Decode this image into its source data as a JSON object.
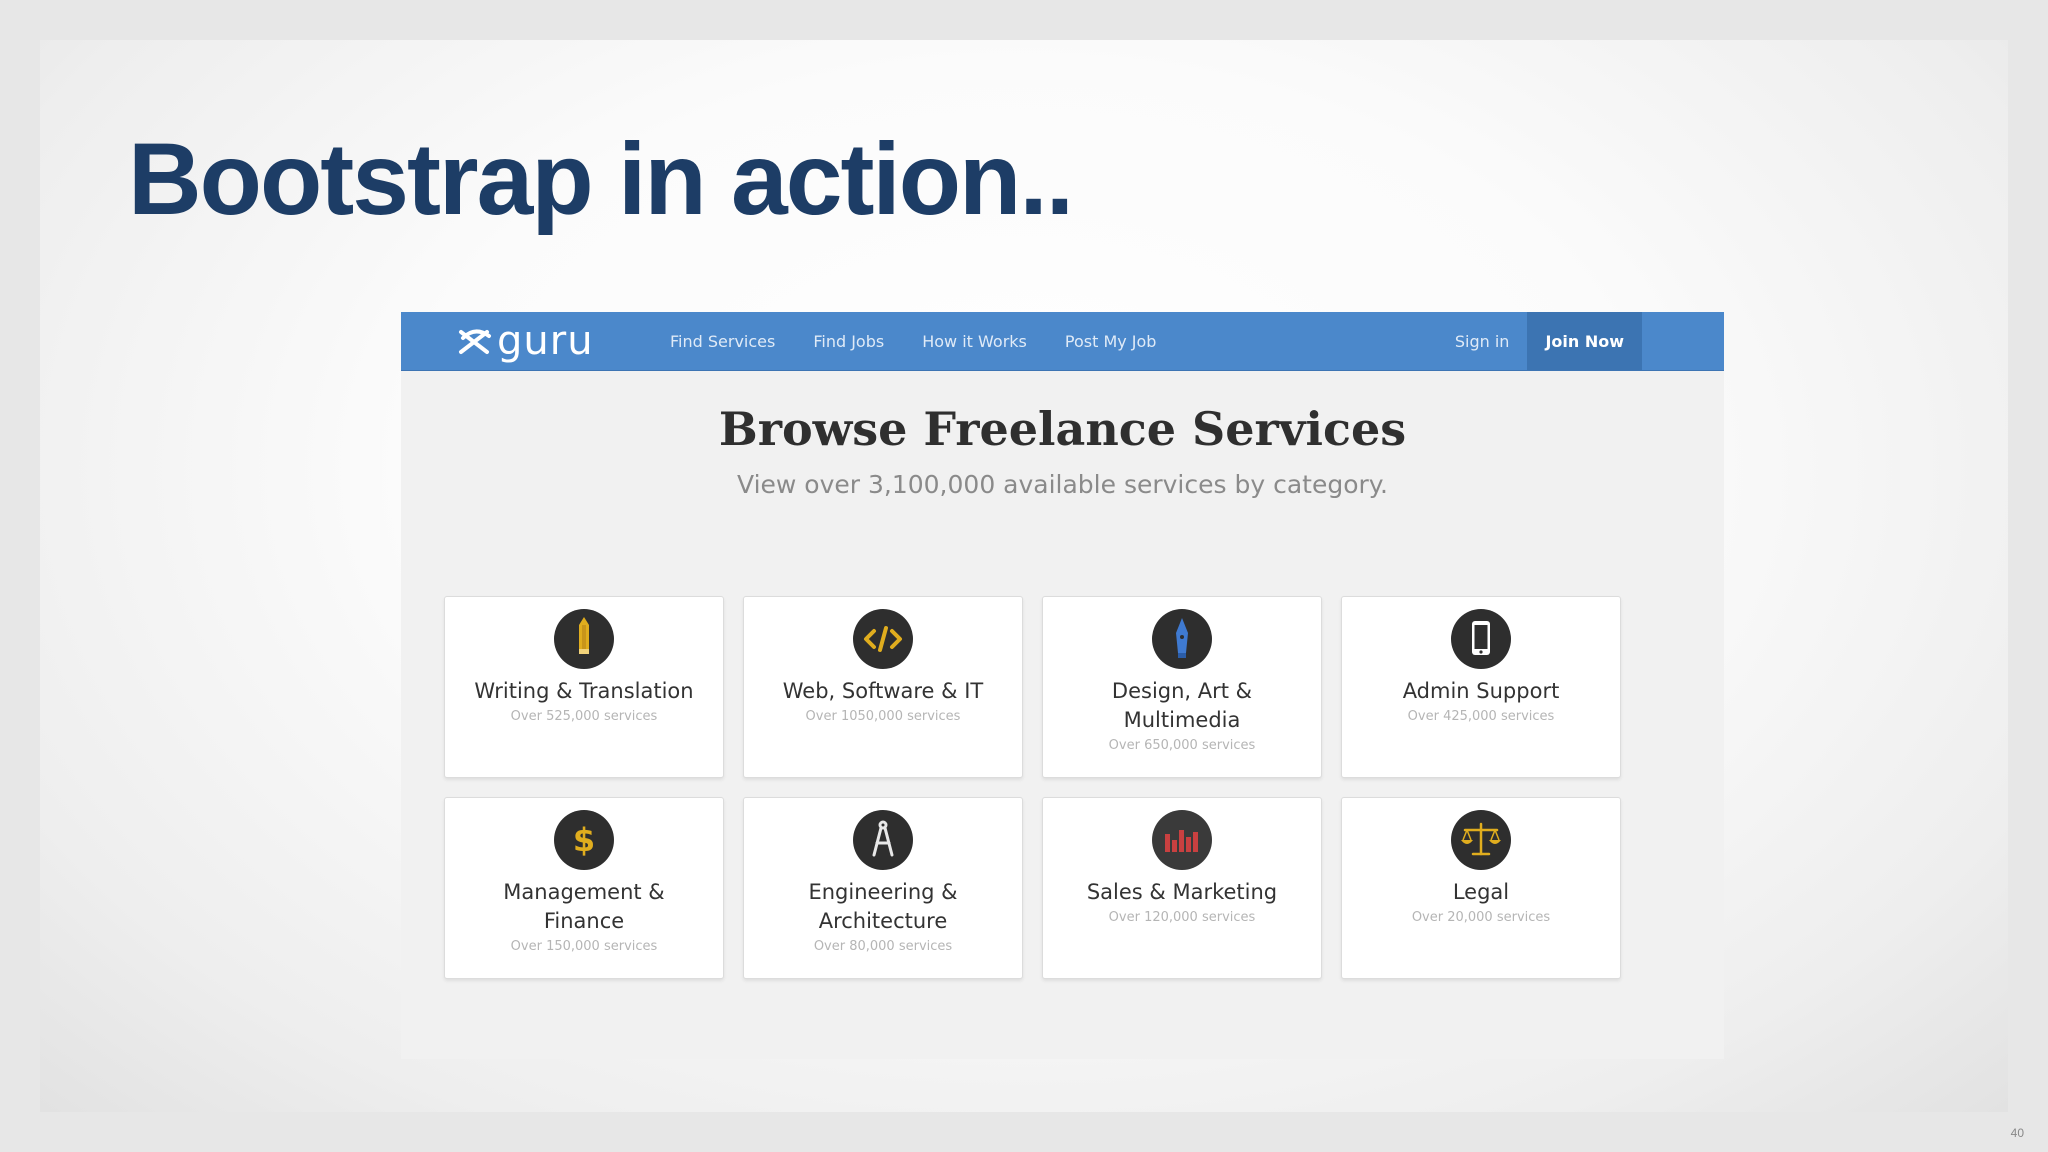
{
  "slide": {
    "title": "Bootstrap in action..",
    "page_number": "40"
  },
  "site": {
    "brand": "guru",
    "nav": [
      "Find Services",
      "Find Jobs",
      "How it Works",
      "Post My Job"
    ],
    "sign_in": "Sign in",
    "join_now": "Join Now",
    "heading": "Browse Freelance Services",
    "subheading": "View over 3,100,000 available services by category.",
    "categories": [
      {
        "title": "Writing & Translation",
        "count": "Over 525,000 services",
        "icon": "pencil-icon"
      },
      {
        "title": "Web, Software & IT",
        "count": "Over 1050,000 services",
        "icon": "code-icon"
      },
      {
        "title": "Design, Art & Multimedia",
        "count": "Over 650,000 services",
        "icon": "pen-nib-icon"
      },
      {
        "title": "Admin Support",
        "count": "Over 425,000 services",
        "icon": "phone-icon"
      },
      {
        "title": "Management & Finance",
        "count": "Over 150,000 services",
        "icon": "dollar-icon"
      },
      {
        "title": "Engineering & Architecture",
        "count": "Over 80,000 services",
        "icon": "compass-icon"
      },
      {
        "title": "Sales & Marketing",
        "count": "Over 120,000 services",
        "icon": "bar-chart-icon"
      },
      {
        "title": "Legal",
        "count": "Over 20,000 services",
        "icon": "scales-icon"
      }
    ]
  },
  "colors": {
    "slide_title": "#1d3d66",
    "navbar": "#4b88cb",
    "join_button": "#3c74b2",
    "icon_circle": "#2e2e2e",
    "icon_gold": "#e0ad1e",
    "icon_blue": "#3f7ad1",
    "icon_red": "#c94040"
  }
}
